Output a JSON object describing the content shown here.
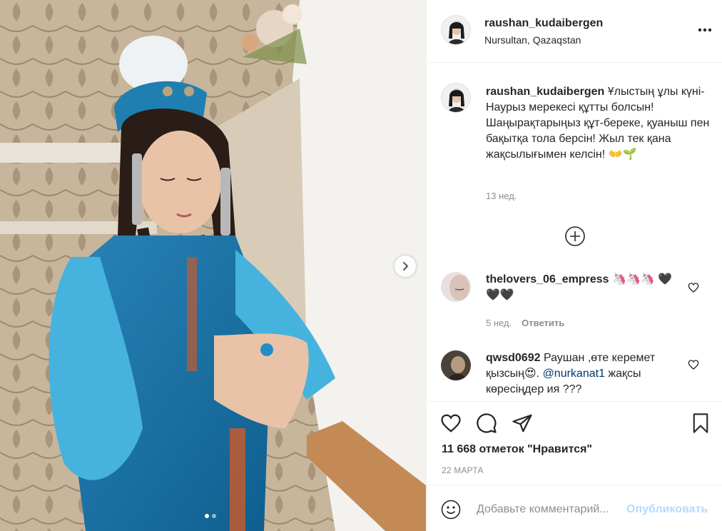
{
  "post": {
    "username": "raushan_kudaibergen",
    "location": "Nursultan, Qazaqstan",
    "caption_text": "Ұлыстың ұлы күні-Наурыз мерекесі құтты болсын! Шаңырақтарыңыз құт-береке, қуаныш пен бақытқа тола берсін! Жыл тек қана жақсылығымен келсін! 👐🌱",
    "caption_time": "13 нед.",
    "likes_text": "11 668 отметок \"Нравится\"",
    "date": "22 МАРТА",
    "carousel": {
      "slides": 2,
      "active": 1
    }
  },
  "comments": [
    {
      "username": "thelovers_06_empress",
      "text": "🦄🦄🦄 🖤🖤🖤",
      "time": "5 нед.",
      "reply_label": "Ответить"
    },
    {
      "username": "qwsd0692",
      "text_before": "Раушан ,өте керемет қызсың😍. ",
      "mention": "@nurkanat1",
      "text_after": " жақсы көресіңдер ия ???"
    }
  ],
  "add_comment": {
    "placeholder": "Добавьте комментарий...",
    "post_label": "Опубликовать"
  },
  "icons": {
    "more": "more-horizontal-icon",
    "load_more": "plus-circle-icon",
    "like": "heart-icon",
    "comment": "comment-icon",
    "share": "paper-plane-icon",
    "save": "bookmark-icon",
    "emoji": "smile-icon",
    "next": "chevron-right-icon"
  },
  "colors": {
    "link": "#00376b",
    "muted": "#8e8e8e",
    "post_disabled": "#b3dbff",
    "text": "#262626"
  }
}
